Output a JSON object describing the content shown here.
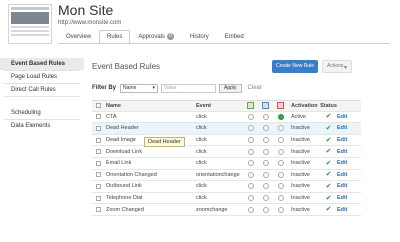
{
  "site": {
    "title": "Mon Site",
    "url": "http://www.monsite.com"
  },
  "tabs": [
    {
      "label": "Overview"
    },
    {
      "label": "Rules"
    },
    {
      "label": "Approvals",
      "badge": "0"
    },
    {
      "label": "History"
    },
    {
      "label": "Embed"
    }
  ],
  "sidebar": {
    "items": [
      {
        "label": "Event Based Rules"
      },
      {
        "label": "Page Load Rules"
      },
      {
        "label": "Direct Call Rules"
      },
      {
        "label": "Scheduling"
      },
      {
        "label": "Data Elements"
      }
    ]
  },
  "main": {
    "section_title": "Event Based Rules",
    "create_label": "Create New Rule",
    "actions_label": "Actions",
    "filter": {
      "label": "Filter By",
      "select_value": "Name",
      "input_placeholder": "Value",
      "apply_label": "Apply",
      "clear_label": "Clear"
    },
    "columns": {
      "name": "Name",
      "event": "Event",
      "activation": "Activation",
      "status": "Status"
    },
    "rows": [
      {
        "name": "CTA",
        "event": "click",
        "activation": "Active",
        "edit": "Edit"
      },
      {
        "name": "Dead Header",
        "event": "click",
        "activation": "Inactive",
        "edit": "Edit"
      },
      {
        "name": "Dead Image",
        "event": "click",
        "activation": "Inactive",
        "edit": "Edit"
      },
      {
        "name": "Download Link",
        "event": "click",
        "activation": "Inactive",
        "edit": "Edit"
      },
      {
        "name": "Email Link",
        "event": "click",
        "activation": "Inactive",
        "edit": "Edit"
      },
      {
        "name": "Orientation Changed",
        "event": "orientationchange",
        "activation": "Inactive",
        "edit": "Edit"
      },
      {
        "name": "Outbound Link",
        "event": "click",
        "activation": "Inactive",
        "edit": "Edit"
      },
      {
        "name": "Telephone Dial",
        "event": "click",
        "activation": "Inactive",
        "edit": "Edit"
      },
      {
        "name": "Zoom Changed",
        "event": "zoomchange",
        "activation": "Inactive",
        "edit": "Edit"
      }
    ],
    "tooltip": "Dead Header"
  },
  "colors": {
    "accent": "#3b7ec4",
    "active_green": "#36a43f",
    "row_highlight": "#ebf3fb",
    "link": "#2b6cb0"
  }
}
